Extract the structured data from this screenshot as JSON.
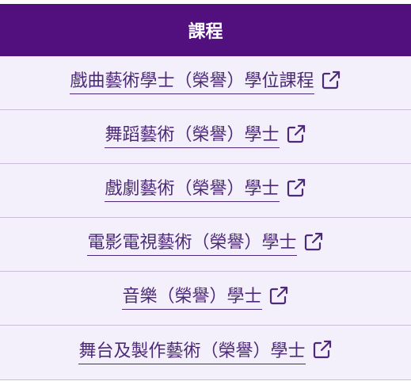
{
  "header": {
    "title": "課程"
  },
  "courses": [
    {
      "label": "戲曲藝術學士（榮譽）學位課程",
      "icon": "external-link-icon"
    },
    {
      "label": "舞蹈藝術（榮譽）學士",
      "icon": "external-link-icon"
    },
    {
      "label": "戲劇藝術（榮譽）學士",
      "icon": "external-link-icon"
    },
    {
      "label": "電影電視藝術（榮譽）學士",
      "icon": "external-link-icon"
    },
    {
      "label": "音樂（榮譽）學士",
      "icon": "external-link-icon"
    },
    {
      "label": "舞台及製作藝術（榮譽）學士",
      "icon": "external-link-icon"
    }
  ],
  "colors": {
    "header_bg": "#52107f",
    "row_bg": "#f4f0fb",
    "link": "#4c2a77",
    "divider": "#c9bdd9"
  }
}
